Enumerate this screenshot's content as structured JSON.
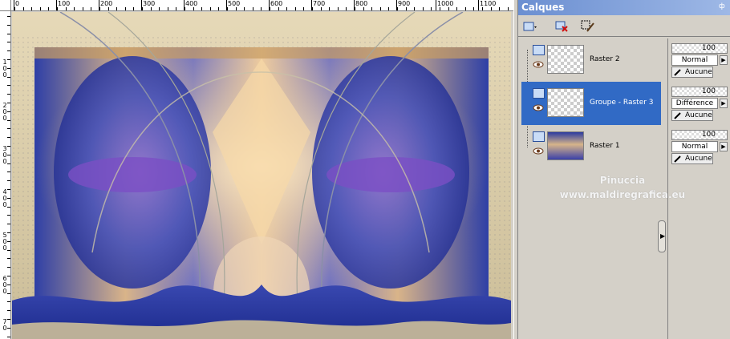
{
  "palette": {
    "title": "Calques",
    "toolbar": {
      "new_layer_icon": "new-layer-icon",
      "delete_layer_icon": "delete-layer-icon",
      "edit_selection_icon": "edit-selection-icon"
    },
    "layers": [
      {
        "name": "Raster 2",
        "opacity": "100",
        "blend": "Normal",
        "mask": "Aucune",
        "selected": false
      },
      {
        "name": "Groupe - Raster 3",
        "opacity": "100",
        "blend": "Différence",
        "mask": "Aucune",
        "selected": true
      },
      {
        "name": "Raster 1",
        "opacity": "100",
        "blend": "Normal",
        "mask": "Aucune",
        "selected": false
      }
    ],
    "watermark_line1": "Pinuccia",
    "watermark_line2": "www.maldiregrafica.eu",
    "expand_label": "▶"
  },
  "rulers": {
    "top": [
      "0",
      "100",
      "200",
      "300",
      "400",
      "500",
      "600",
      "700",
      "800",
      "900",
      "1000",
      "1100"
    ],
    "left": [
      "1\n0\n0",
      "2\n0\n0",
      "3\n0\n0",
      "4\n0\n0",
      "5\n0\n0",
      "6\n0\n0",
      "7\n0"
    ]
  },
  "colors": {
    "selection": "#316ac5",
    "title_bar": "#7a9bdc",
    "panel": "#d4d0c8"
  }
}
